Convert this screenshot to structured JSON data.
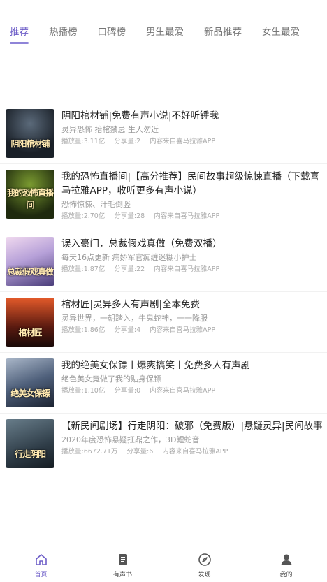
{
  "tabs": [
    {
      "label": "推荐",
      "active": true
    },
    {
      "label": "热播榜",
      "active": false
    },
    {
      "label": "口碑榜",
      "active": false
    },
    {
      "label": "男生最爱",
      "active": false
    },
    {
      "label": "新品推荐",
      "active": false
    },
    {
      "label": "女生最爱",
      "active": false
    }
  ],
  "items": [
    {
      "title": "阴阳棺材铺|免费有声小说|不好听锤我",
      "desc": "灵异恐怖 抬棺禁忌 生人勿近",
      "plays": "播放量:3.11亿",
      "shares": "分享量:2",
      "source": "内容来自喜马拉雅APP",
      "cover_text": "阴阳棺材铺"
    },
    {
      "title": "我的恐怖直播间|【高分推荐】民间故事超级惊悚直播（下载喜马拉雅APP，收听更多有声小说）",
      "desc": "恐怖惊悚、汗毛倒竖",
      "plays": "播放量:2.70亿",
      "shares": "分享量:28",
      "source": "内容来自喜马拉雅APP",
      "cover_text": "我的恐怖直播间"
    },
    {
      "title": "误入豪门，总裁假戏真做（免费双播）",
      "desc": "每天16点更新 病娇军官痴缠迷糊小护士",
      "plays": "播放量:1.87亿",
      "shares": "分享量:22",
      "source": "内容来自喜马拉雅APP",
      "cover_text": "总裁假戏真做"
    },
    {
      "title": "棺材匠|灵异多人有声剧|全本免费",
      "desc": "灵异世界，一朝踏入，牛鬼蛇神，一一降服",
      "plays": "播放量:1.86亿",
      "shares": "分享量:4",
      "source": "内容来自喜马拉雅APP",
      "cover_text": "棺材匠"
    },
    {
      "title": "我的绝美女保镖丨爆爽搞笑丨免费多人有声剧",
      "desc": "绝色美女竟做了我的贴身保镖",
      "plays": "播放量:1.10亿",
      "shares": "分享量:0",
      "source": "内容来自喜马拉雅APP",
      "cover_text": "绝美女保镖"
    },
    {
      "title": "【新民间剧场】行走阴阳：破邪（免费版）|悬疑灵异|民间故事",
      "desc": "2020年度恐怖悬疑扛鼎之作，3D鲤蛇音",
      "plays": "播放量:6672.71万",
      "shares": "分享量:6",
      "source": "内容来自喜马拉雅APP",
      "cover_text": "行走阴阳"
    }
  ],
  "nav": [
    {
      "label": "首页",
      "icon": "home-icon",
      "active": true
    },
    {
      "label": "有声书",
      "icon": "book-icon",
      "active": false
    },
    {
      "label": "发现",
      "icon": "compass-icon",
      "active": false
    },
    {
      "label": "我的",
      "icon": "user-icon",
      "active": false
    }
  ],
  "colors": {
    "accent": "#6e5ec8",
    "underline": "#8f84d8"
  }
}
